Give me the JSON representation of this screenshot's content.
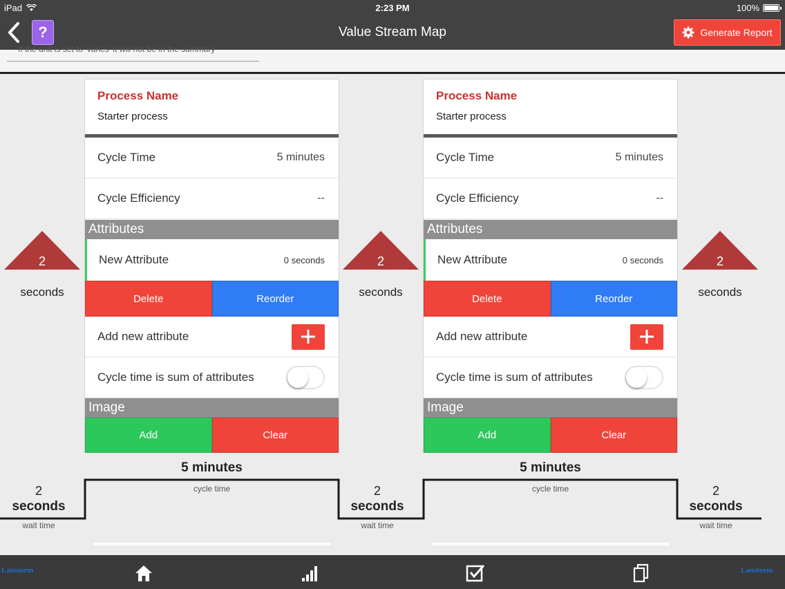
{
  "status": {
    "device": "iPad",
    "time": "2:23 PM",
    "battery": "100%"
  },
  "nav": {
    "title": "Value Stream Map",
    "help": "?",
    "report_label": "Generate Report"
  },
  "note": "If the unit is set to 'varies' it will not be in the summary",
  "panels": [
    {
      "process_label": "Process Name",
      "process_value": "Starter process",
      "cycle_time_label": "Cycle Time",
      "cycle_time_value": "5 minutes",
      "efficiency_label": "Cycle Efficiency",
      "efficiency_value": "--",
      "attributes_header": "Attributes",
      "attribute_name": "New Attribute",
      "attribute_value": "0 seconds",
      "delete_label": "Delete",
      "reorder_label": "Reorder",
      "add_attr_label": "Add new attribute",
      "sum_label": "Cycle time is sum of attributes",
      "image_header": "Image",
      "add_label": "Add",
      "clear_label": "Clear",
      "cycle_summary": "5 minutes",
      "cycle_summary_label": "cycle time"
    },
    {
      "process_label": "Process Name",
      "process_value": "Starter process",
      "cycle_time_label": "Cycle Time",
      "cycle_time_value": "5 minutes",
      "efficiency_label": "Cycle Efficiency",
      "efficiency_value": "--",
      "attributes_header": "Attributes",
      "attribute_name": "New Attribute",
      "attribute_value": "0 seconds",
      "delete_label": "Delete",
      "reorder_label": "Reorder",
      "add_attr_label": "Add new attribute",
      "sum_label": "Cycle time is sum of attributes",
      "image_header": "Image",
      "add_label": "Add",
      "clear_label": "Clear",
      "cycle_summary": "5 minutes",
      "cycle_summary_label": "cycle time"
    }
  ],
  "inventory": [
    {
      "value": "2",
      "unit": "seconds"
    },
    {
      "value": "2",
      "unit": "seconds"
    },
    {
      "value": "2",
      "unit": "seconds"
    }
  ],
  "waits": [
    {
      "value": "2",
      "unit": "seconds",
      "label": "wait time"
    },
    {
      "value": "2",
      "unit": "seconds",
      "label": "wait time"
    },
    {
      "value": "2",
      "unit": "seconds",
      "label": "wait time"
    }
  ],
  "footer": {
    "brand_left": "Lanstorm",
    "brand_right": "Lanstorm"
  },
  "colors": {
    "accent_red": "#f0443a",
    "accent_blue": "#2f7cf6",
    "accent_green": "#2dc85c",
    "process_red": "#c7312f",
    "triangle": "#b03a3a"
  },
  "icons": {
    "back": "chevron-left-icon",
    "settings": "gear-icon",
    "home": "home-icon",
    "stats": "bar-chart-icon",
    "tasks": "checkbox-icon",
    "docs": "documents-icon"
  }
}
